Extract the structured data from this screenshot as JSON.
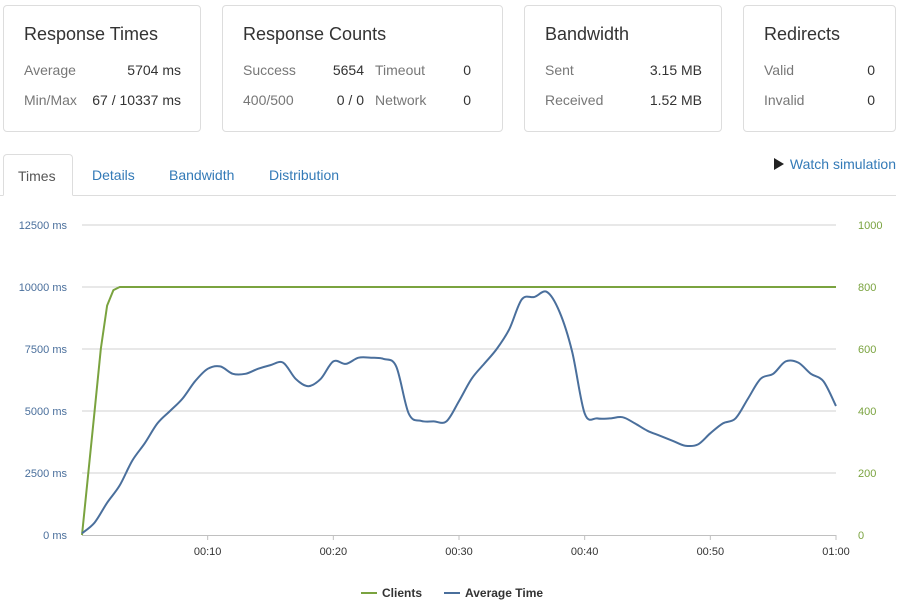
{
  "cards": {
    "response_times": {
      "title": "Response Times",
      "average_label": "Average",
      "average_value": "5704 ms",
      "minmax_label": "Min/Max",
      "minmax_value": "67 / 10337 ms"
    },
    "response_counts": {
      "title": "Response Counts",
      "success_label": "Success",
      "success_value": "5654",
      "timeout_label": "Timeout",
      "timeout_value": "0",
      "errors_label": "400/500",
      "errors_value": "0 / 0",
      "network_label": "Network",
      "network_value": "0"
    },
    "bandwidth": {
      "title": "Bandwidth",
      "sent_label": "Sent",
      "sent_value": "3.15 MB",
      "received_label": "Received",
      "received_value": "1.52 MB"
    },
    "redirects": {
      "title": "Redirects",
      "valid_label": "Valid",
      "valid_value": "0",
      "invalid_label": "Invalid",
      "invalid_value": "0"
    }
  },
  "tabs": [
    {
      "label": "Times",
      "active": true
    },
    {
      "label": "Details",
      "active": false
    },
    {
      "label": "Bandwidth",
      "active": false
    },
    {
      "label": "Distribution",
      "active": false
    }
  ],
  "watch_simulation": "Watch simulation",
  "colors": {
    "clients": "#7aa33f",
    "average_time": "#4a6f9c",
    "link": "#337ab7",
    "grid": "#d0d0d0"
  },
  "chart_data": {
    "type": "line",
    "x_ticks": [
      "00:10",
      "00:20",
      "00:30",
      "00:40",
      "00:50",
      "01:00"
    ],
    "xlim": [
      0,
      60
    ],
    "y_left": {
      "ticks": [
        "0 ms",
        "2500 ms",
        "5000 ms",
        "7500 ms",
        "10000 ms",
        "12500 ms"
      ],
      "lim": [
        0,
        12500
      ]
    },
    "y_right": {
      "ticks": [
        "0",
        "200",
        "400",
        "600",
        "800",
        "1000"
      ],
      "lim": [
        0,
        1000
      ]
    },
    "legend_position": "bottom",
    "series": [
      {
        "name": "Clients",
        "axis": "right",
        "x": [
          0,
          0.5,
          1,
          1.5,
          2,
          2.5,
          3,
          3.5,
          60
        ],
        "values": [
          0,
          200,
          400,
          600,
          740,
          790,
          800,
          800,
          800
        ]
      },
      {
        "name": "Average Time",
        "axis": "left",
        "x": [
          0,
          1,
          2,
          3,
          4,
          5,
          6,
          7,
          8,
          9,
          10,
          11,
          12,
          13,
          14,
          15,
          16,
          17,
          18,
          19,
          20,
          21,
          22,
          23,
          24,
          25,
          26,
          27,
          28,
          29,
          30,
          31,
          32,
          33,
          34,
          35,
          36,
          37,
          38,
          39,
          40,
          41,
          42,
          43,
          44,
          45,
          46,
          47,
          48,
          49,
          50,
          51,
          52,
          53,
          54,
          55,
          56,
          57,
          58,
          59,
          60
        ],
        "values": [
          67,
          500,
          1300,
          2000,
          3000,
          3700,
          4500,
          5000,
          5500,
          6200,
          6700,
          6800,
          6500,
          6500,
          6700,
          6850,
          6950,
          6300,
          6000,
          6300,
          7000,
          6900,
          7150,
          7150,
          7100,
          6800,
          4900,
          4600,
          4580,
          4580,
          5400,
          6300,
          6900,
          7500,
          8300,
          9500,
          9600,
          9800,
          9000,
          7400,
          4900,
          4700,
          4700,
          4750,
          4500,
          4200,
          4000,
          3800,
          3600,
          3650,
          4100,
          4500,
          4700,
          5500,
          6300,
          6500,
          7000,
          6950,
          6500,
          6200,
          5200
        ]
      }
    ]
  }
}
